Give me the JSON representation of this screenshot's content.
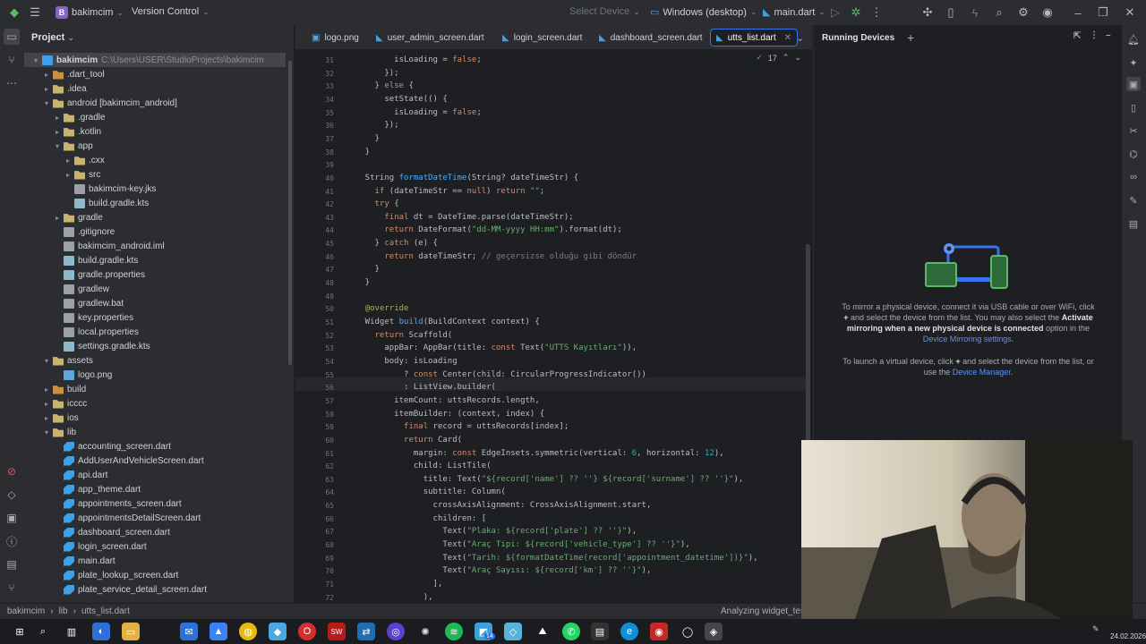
{
  "titlebar": {
    "project_initial": "B",
    "project_name": "bakimcim",
    "vcs": "Version Control",
    "device_select": "Select Device",
    "run_target": "Windows (desktop)",
    "run_config": "main.dart"
  },
  "project_panel": {
    "title": "Project",
    "root_name": "bakimcim",
    "root_path": "C:\\Users\\USER\\StudioProjects\\bakimcim",
    "items": [
      {
        "label": ".dart_tool",
        "indent": 1,
        "type": "folder-ex",
        "twisty": "▸"
      },
      {
        "label": ".idea",
        "indent": 1,
        "type": "folder",
        "twisty": "▸"
      },
      {
        "label": "android [bakimcim_android]",
        "indent": 1,
        "type": "folder",
        "twisty": "▾"
      },
      {
        "label": ".gradle",
        "indent": 2,
        "type": "folder",
        "twisty": "▸"
      },
      {
        "label": ".kotlin",
        "indent": 2,
        "type": "folder",
        "twisty": "▸"
      },
      {
        "label": "app",
        "indent": 2,
        "type": "folder",
        "twisty": "▾"
      },
      {
        "label": ".cxx",
        "indent": 3,
        "type": "folder",
        "twisty": "▸"
      },
      {
        "label": "src",
        "indent": 3,
        "type": "folder",
        "twisty": "▸"
      },
      {
        "label": "bakimcim-key.jks",
        "indent": 3,
        "type": "txt",
        "twisty": ""
      },
      {
        "label": "build.gradle.kts",
        "indent": 3,
        "type": "gradle",
        "twisty": ""
      },
      {
        "label": "gradle",
        "indent": 2,
        "type": "folder",
        "twisty": "▸"
      },
      {
        "label": ".gitignore",
        "indent": 2,
        "type": "txt",
        "twisty": ""
      },
      {
        "label": "bakimcim_android.iml",
        "indent": 2,
        "type": "txt",
        "twisty": ""
      },
      {
        "label": "build.gradle.kts",
        "indent": 2,
        "type": "gradle",
        "twisty": ""
      },
      {
        "label": "gradle.properties",
        "indent": 2,
        "type": "gradle",
        "twisty": ""
      },
      {
        "label": "gradlew",
        "indent": 2,
        "type": "txt",
        "twisty": ""
      },
      {
        "label": "gradlew.bat",
        "indent": 2,
        "type": "txt",
        "twisty": ""
      },
      {
        "label": "key.properties",
        "indent": 2,
        "type": "txt",
        "twisty": ""
      },
      {
        "label": "local.properties",
        "indent": 2,
        "type": "txt",
        "twisty": ""
      },
      {
        "label": "settings.gradle.kts",
        "indent": 2,
        "type": "gradle",
        "twisty": ""
      },
      {
        "label": "assets",
        "indent": 1,
        "type": "folder",
        "twisty": "▾"
      },
      {
        "label": "logo.png",
        "indent": 2,
        "type": "img",
        "twisty": ""
      },
      {
        "label": "build",
        "indent": 1,
        "type": "folder-ex",
        "twisty": "▸"
      },
      {
        "label": "icccc",
        "indent": 1,
        "type": "folder",
        "twisty": "▸"
      },
      {
        "label": "ios",
        "indent": 1,
        "type": "folder",
        "twisty": "▸"
      },
      {
        "label": "lib",
        "indent": 1,
        "type": "folder",
        "twisty": "▾"
      },
      {
        "label": "accounting_screen.dart",
        "indent": 2,
        "type": "dart",
        "twisty": ""
      },
      {
        "label": "AddUserAndVehicleScreen.dart",
        "indent": 2,
        "type": "dart",
        "twisty": ""
      },
      {
        "label": "api.dart",
        "indent": 2,
        "type": "dart",
        "twisty": ""
      },
      {
        "label": "app_theme.dart",
        "indent": 2,
        "type": "dart",
        "twisty": ""
      },
      {
        "label": "appointments_screen.dart",
        "indent": 2,
        "type": "dart",
        "twisty": ""
      },
      {
        "label": "appointmentsDetailScreen.dart",
        "indent": 2,
        "type": "dart",
        "twisty": ""
      },
      {
        "label": "dashboard_screen.dart",
        "indent": 2,
        "type": "dart",
        "twisty": ""
      },
      {
        "label": "login_screen.dart",
        "indent": 2,
        "type": "dart",
        "twisty": ""
      },
      {
        "label": "main.dart",
        "indent": 2,
        "type": "dart",
        "twisty": ""
      },
      {
        "label": "plate_lookup_screen.dart",
        "indent": 2,
        "type": "dart",
        "twisty": ""
      },
      {
        "label": "plate_service_detail_screen.dart",
        "indent": 2,
        "type": "dart",
        "twisty": ""
      }
    ]
  },
  "editor": {
    "tabs": [
      {
        "label": "logo.png",
        "icon": "image-icon"
      },
      {
        "label": "user_admin_screen.dart",
        "icon": "dart-icon"
      },
      {
        "label": "login_screen.dart",
        "icon": "dart-icon"
      },
      {
        "label": "dashboard_screen.dart",
        "icon": "dart-icon"
      },
      {
        "label": "utts_list.dart",
        "icon": "dart-icon",
        "active": true
      }
    ],
    "inspection_count": "17",
    "current_line": "56",
    "lines": [
      {
        "n": "31",
        "html": "          isLoading = <span class=\"kw\">false</span>;"
      },
      {
        "n": "32",
        "html": "        });"
      },
      {
        "n": "33",
        "html": "      } <span class=\"kw\">else</span> {"
      },
      {
        "n": "34",
        "html": "        setState(() {"
      },
      {
        "n": "35",
        "html": "          isLoading = <span class=\"kw\">false</span>;"
      },
      {
        "n": "36",
        "html": "        });"
      },
      {
        "n": "37",
        "html": "      }"
      },
      {
        "n": "38",
        "html": "    }"
      },
      {
        "n": "39",
        "html": ""
      },
      {
        "n": "40",
        "html": "    String <span class=\"fn\">formatDateTime</span>(String? dateTimeStr) {"
      },
      {
        "n": "41",
        "html": "      <span class=\"kw\">if</span> (dateTimeStr == <span class=\"kw\">null</span>) <span class=\"kw\">return</span> <span class=\"str\">\"\"</span>;"
      },
      {
        "n": "42",
        "html": "      <span class=\"kw\">try</span> {"
      },
      {
        "n": "43",
        "html": "        <span class=\"kw\">final</span> dt = DateTime.parse(dateTimeStr);"
      },
      {
        "n": "44",
        "html": "        <span class=\"kw\">return</span> DateFormat(<span class=\"str\">\"dd-MM-yyyy HH:mm\"</span>).format(dt);"
      },
      {
        "n": "45",
        "html": "      } <span class=\"kw\">catch</span> (e) {"
      },
      {
        "n": "46",
        "html": "        <span class=\"kw\">return</span> dateTimeStr; <span class=\"cm\">// geçersizse olduğu gibi döndür</span>"
      },
      {
        "n": "47",
        "html": "      }"
      },
      {
        "n": "48",
        "html": "    }"
      },
      {
        "n": "49",
        "html": ""
      },
      {
        "n": "50",
        "html": "    <span class=\"ann\">@override</span>"
      },
      {
        "n": "51",
        "html": "    Widget <span class=\"fn\">build</span>(BuildContext context) {"
      },
      {
        "n": "52",
        "html": "      <span class=\"kw\">return</span> Scaffold("
      },
      {
        "n": "53",
        "html": "        appBar: AppBar(title: <span class=\"kw\">const</span> Text(<span class=\"str\">\"UTTS Kayıtları\"</span>)),"
      },
      {
        "n": "54",
        "html": "        body: isLoading"
      },
      {
        "n": "55",
        "html": "            ? <span class=\"kw\">const</span> Center(child: CircularProgressIndicator())"
      },
      {
        "n": "56",
        "html": "            : ListView.builder("
      },
      {
        "n": "57",
        "html": "          itemCount: uttsRecords.length,"
      },
      {
        "n": "58",
        "html": "          itemBuilder: (context, index) {"
      },
      {
        "n": "59",
        "html": "            <span class=\"kw\">final</span> record = uttsRecords[index];"
      },
      {
        "n": "60",
        "html": "            <span class=\"kw\">return</span> Card("
      },
      {
        "n": "61",
        "html": "              margin: <span class=\"kw\">const</span> EdgeInsets.symmetric(vertical: <span class=\"num\">6</span>, horizontal: <span class=\"num\">12</span>),"
      },
      {
        "n": "62",
        "html": "              child: ListTile("
      },
      {
        "n": "63",
        "html": "                title: Text(<span class=\"str\">\"${record['name'] ?? ''} ${record['surname'] ?? ''}\"</span>),"
      },
      {
        "n": "64",
        "html": "                subtitle: Column("
      },
      {
        "n": "65",
        "html": "                  crossAxisAlignment: CrossAxisAlignment.start,"
      },
      {
        "n": "66",
        "html": "                  children: ["
      },
      {
        "n": "67",
        "html": "                    Text(<span class=\"str\">\"Plaka: ${record['plate'] ?? ''}\"</span>),"
      },
      {
        "n": "68",
        "html": "                    Text(<span class=\"str\">\"Araç Tipi: ${record['vehicle_type'] ?? ''}\"</span>),"
      },
      {
        "n": "69",
        "html": "                    Text(<span class=\"str\">\"Tarih: ${formatDateTime(record['appointment_datetime'])}\"</span>),"
      },
      {
        "n": "70",
        "html": "                    Text(<span class=\"str\">\"Araç Sayısı: ${record['km'] ?? ''}\"</span>),"
      },
      {
        "n": "71",
        "html": "                  ],"
      },
      {
        "n": "72",
        "html": "                ),"
      }
    ]
  },
  "running_devices": {
    "title": "Running Devices",
    "para1_a": "To mirror a physical device, connect it via USB cable or over WiFi, click",
    "para1_b": "and select the device from the list. You may also select the",
    "para1_bold": "Activate mirroring when a new physical device is connected",
    "para1_c": "option in the",
    "para1_link": "Device Mirroring settings",
    "para2_a": "To launch a virtual device, click",
    "para2_b": "and select the device from the list, or use the",
    "para2_link": "Device Manager"
  },
  "statusbar": {
    "crumbs": [
      "bakimcim",
      "lib",
      "utts_list.dart"
    ],
    "analyzing": "Analyzing widget_tes"
  },
  "taskbar": {
    "date": "24.02.2026",
    "badge_count": "14"
  },
  "colors": {
    "accent": "#3574f0",
    "project_badge": "#8b61c7"
  }
}
